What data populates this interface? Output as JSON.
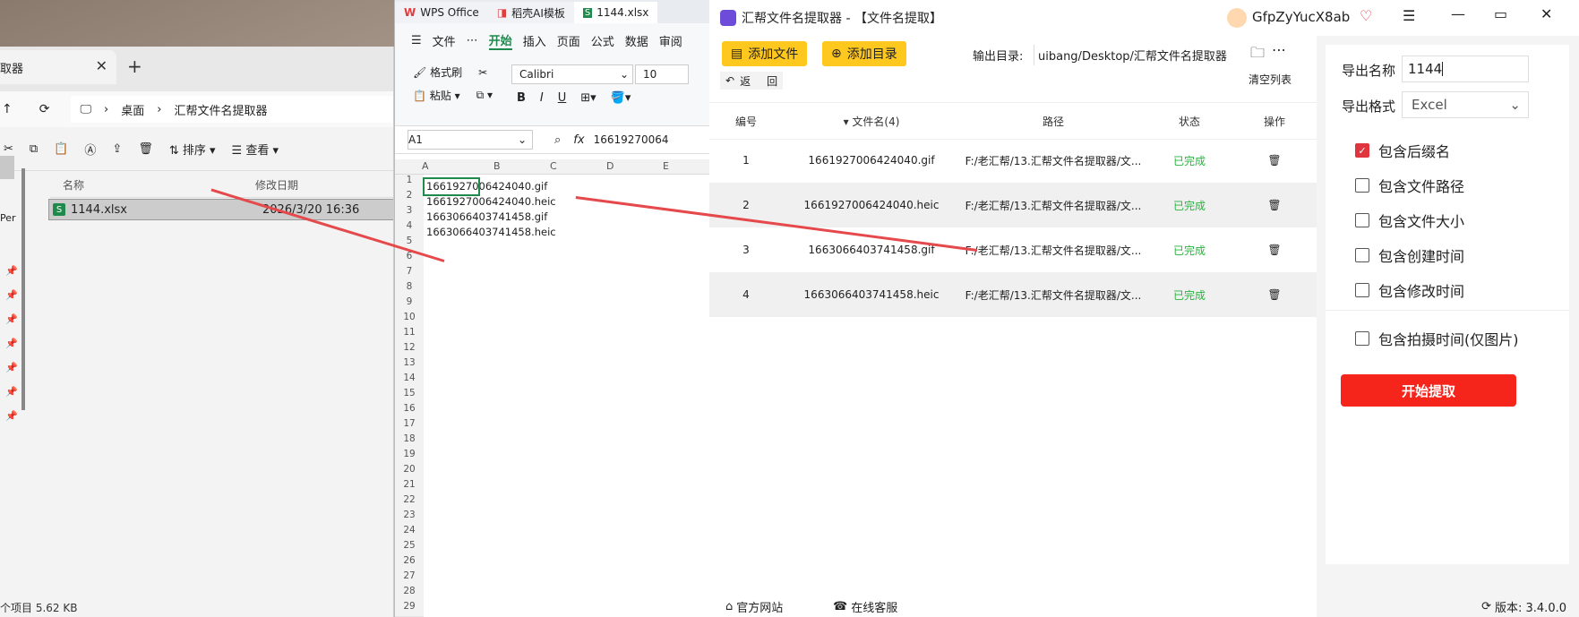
{
  "explorer": {
    "tab_title": "取器",
    "address": [
      "桌面",
      "汇帮文件名提取器"
    ],
    "toolbar": {
      "sort": "排序",
      "view": "查看"
    },
    "columns": {
      "name": "名称",
      "modified": "修改日期"
    },
    "file": {
      "name": "1144.xlsx",
      "modified": "2026/3/20 16:36"
    },
    "side_label": "Per",
    "status": "个项目  5.62 KB"
  },
  "wps": {
    "tabs": [
      "WPS Office",
      "稻壳AI模板",
      "1144.xlsx"
    ],
    "menu": [
      "文件",
      "开始",
      "插入",
      "页面",
      "公式",
      "数据",
      "审阅"
    ],
    "ribbon": {
      "format_painter": "格式刷",
      "paste": "粘贴",
      "font": "Calibri",
      "size": "10"
    },
    "cell_ref": "A1",
    "formula": "16619270064",
    "columns": [
      "A",
      "B",
      "C",
      "D",
      "E"
    ],
    "cells": [
      "1661927006424040.gif",
      "1661927006424040.heic",
      "1663066403741458.gif",
      "1663066403741458.heic"
    ],
    "row_numbers": [
      "1",
      "2",
      "3",
      "4",
      "5",
      "6",
      "7",
      "8",
      "9",
      "10",
      "11",
      "12",
      "13",
      "14",
      "15",
      "16",
      "17",
      "18",
      "19",
      "20",
      "21",
      "22",
      "23",
      "24",
      "25",
      "26",
      "27",
      "28",
      "29"
    ]
  },
  "app": {
    "title": "汇帮文件名提取器 - 【文件名提取】",
    "user": "GfpZyYucX8ab",
    "add_file": "添加文件",
    "add_dir": "添加目录",
    "output_label": "输出目录:",
    "output_path": "uibang/Desktop/汇帮文件名提取器",
    "back": "返",
    "back2": "回",
    "clear": "清空列表",
    "headers": {
      "id": "编号",
      "name": "文件名(4)",
      "path": "路径",
      "status": "状态",
      "op": "操作"
    },
    "rows": [
      {
        "id": "1",
        "name": "1661927006424040.gif",
        "path": "F:/老汇帮/13.汇帮文件名提取器/文...",
        "status": "已完成"
      },
      {
        "id": "2",
        "name": "1661927006424040.heic",
        "path": "F:/老汇帮/13.汇帮文件名提取器/文...",
        "status": "已完成"
      },
      {
        "id": "3",
        "name": "1663066403741458.gif",
        "path": "F:/老汇帮/13.汇帮文件名提取器/文...",
        "status": "已完成"
      },
      {
        "id": "4",
        "name": "1663066403741458.heic",
        "path": "F:/老汇帮/13.汇帮文件名提取器/文...",
        "status": "已完成"
      }
    ],
    "export_name_label": "导出名称",
    "export_name_value": "1144",
    "export_format_label": "导出格式",
    "export_format_value": "Excel",
    "options": [
      {
        "label": "包含后缀名",
        "checked": true
      },
      {
        "label": "包含文件路径",
        "checked": false
      },
      {
        "label": "包含文件大小",
        "checked": false
      },
      {
        "label": "包含创建时间",
        "checked": false
      },
      {
        "label": "包含修改时间",
        "checked": false
      },
      {
        "label": "包含拍摄时间(仅图片)",
        "checked": false
      }
    ],
    "start": "开始提取",
    "footer": {
      "website": "官方网站",
      "support": "在线客服",
      "version": "版本: 3.4.0.0"
    }
  },
  "colors": {
    "accent_red": "#f5251b",
    "yellow": "#ffc81e",
    "done_green": "#2ab23f",
    "arrow": "#e5494b"
  }
}
